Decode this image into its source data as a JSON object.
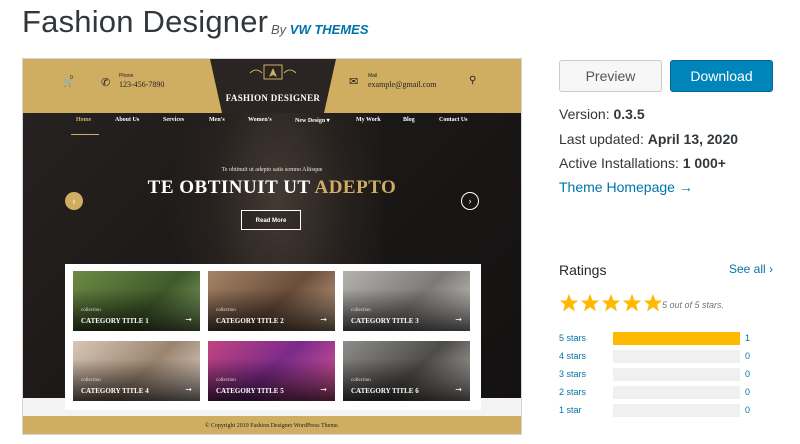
{
  "header": {
    "title": "Fashion Designer",
    "by_prefix": "By",
    "author": "VW THEMES"
  },
  "screenshot": {
    "topbar": {
      "cart_count": "0",
      "phone_label": "Phone",
      "phone_value": "123-456-7890",
      "logo_text": "FASHION DESIGNER",
      "mail_label": "Mail",
      "mail_value": "example@gmail.com"
    },
    "nav": [
      "Home",
      "About Us",
      "Services",
      "Men's",
      "Women's",
      "New Design ▾",
      "My Work",
      "Blog",
      "Contact Us"
    ],
    "hero": {
      "subtitle": "Te obtinuit ut adepto satis somno Aliisque",
      "title_white": "TE OBTINUIT UT ",
      "title_gold": "ADEPTO",
      "button": "Read More"
    },
    "categories": [
      {
        "label": "collection",
        "title": "CATEGORY TITLE 1",
        "color": "#5b7a3c"
      },
      {
        "label": "collection",
        "title": "CATEGORY TITLE 2",
        "color": "#8a6a52"
      },
      {
        "label": "collection",
        "title": "CATEGORY TITLE 3",
        "color": "#9a9896"
      },
      {
        "label": "collection",
        "title": "CATEGORY TITLE 4",
        "color": "#c9b7a8"
      },
      {
        "label": "collection",
        "title": "CATEGORY TITLE 5",
        "color": "#b23a78"
      },
      {
        "label": "collection",
        "title": "CATEGORY TITLE 6",
        "color": "#7d7b77"
      }
    ],
    "footer": "© Copyright 2019 Fashion Designer WordPress Theme."
  },
  "sidebar": {
    "preview_label": "Preview",
    "download_label": "Download",
    "version_label": "Version:",
    "version_value": "0.3.5",
    "updated_label": "Last updated:",
    "updated_value": "April 13, 2020",
    "installs_label": "Active Installations:",
    "installs_value": "1 000+",
    "homepage_label": "Theme Homepage →",
    "ratings_heading": "Ratings",
    "see_all": "See all ›",
    "stars_text": "5 out of 5 stars.",
    "star_rating": 5,
    "rating_rows": [
      {
        "label": "5 stars",
        "count": "1",
        "fraction": 1.0
      },
      {
        "label": "4 stars",
        "count": "0",
        "fraction": 0
      },
      {
        "label": "3 stars",
        "count": "0",
        "fraction": 0
      },
      {
        "label": "2 stars",
        "count": "0",
        "fraction": 0
      },
      {
        "label": "1 star",
        "count": "0",
        "fraction": 0
      }
    ]
  },
  "colors": {
    "gold": "#cfae62",
    "link": "#0073aa",
    "download_bg": "#0085ba",
    "star": "#ffb900"
  }
}
